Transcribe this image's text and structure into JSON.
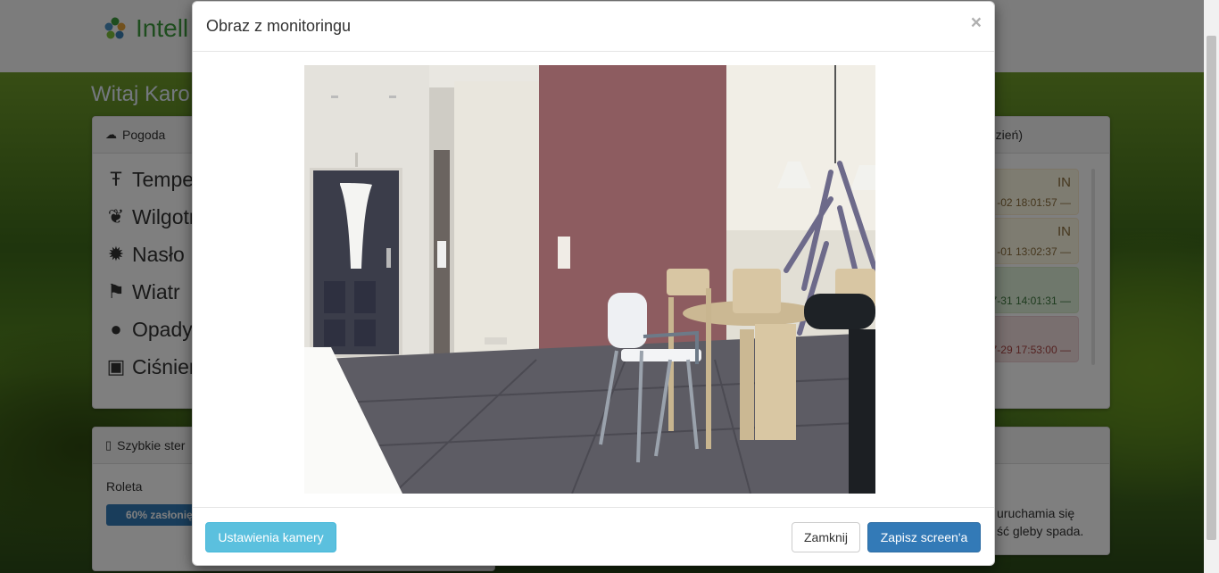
{
  "brand": {
    "name": "Intell"
  },
  "welcome": "Witaj Karo",
  "weather": {
    "header": "Pogoda",
    "items": [
      {
        "icon": "temperature-icon",
        "label": "Tempe"
      },
      {
        "icon": "leaf-icon",
        "label": "Wilgotr"
      },
      {
        "icon": "sun-icon",
        "label": "Nasło"
      },
      {
        "icon": "flag-icon",
        "label": "Wiatr"
      },
      {
        "icon": "drop-icon",
        "label": "Opady"
      },
      {
        "icon": "scale-icon",
        "label": "Ciśnien"
      }
    ]
  },
  "events": {
    "header_suffix": "zień)",
    "items": [
      {
        "title": "IN",
        "date": "-02 18:01:57 —",
        "color": "#fcf8e3"
      },
      {
        "title": "IN",
        "date": "-01 13:02:37 —",
        "color": "#fcf8e3"
      },
      {
        "title": "",
        "date": "7-31 14:01:31 —",
        "color": "#dff0d8"
      },
      {
        "title": "",
        "date": "7-29 17:53:00 —",
        "color": "#f2dede"
      }
    ]
  },
  "quick": {
    "header": "Szybkie ster",
    "roleta_label": "Roleta",
    "roleta_progress_text": "60% zasłonię",
    "roleta_progress": 60
  },
  "info_text": {
    "line1": "uruchamia się",
    "line2": "ść gleby spada."
  },
  "modal": {
    "title": "Obraz z monitoringu",
    "close": "×",
    "buttons": {
      "settings": "Ustawienia kamery",
      "close": "Zamknij",
      "save": "Zapisz screen'a"
    }
  }
}
